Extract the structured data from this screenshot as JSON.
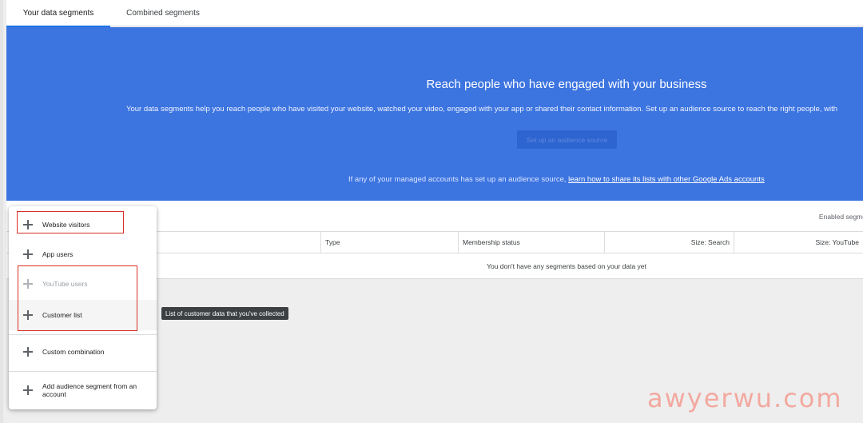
{
  "tabs": [
    {
      "label": "Your data segments",
      "active": true
    },
    {
      "label": "Combined segments",
      "active": false
    }
  ],
  "hero": {
    "title": "Reach people who have engaged with your business",
    "text": "Your data segments help you reach people who have visited your website, watched your video, engaged with your app or shared their contact information. Set up an audience source to reach the right people, with",
    "button_label": "Set up an audience source",
    "note_prefix": "If any of your managed accounts has set up an audience source, ",
    "note_link": "learn how to share its lists with other Google Ads accounts",
    "background_color": "#3c74e0"
  },
  "table": {
    "enabled_label": "Enabled segme",
    "columns": [
      "Type",
      "Membership status",
      "Size: Search",
      "Size: YouTube"
    ],
    "empty_message": "You don't have any segments based on your data yet"
  },
  "menu": {
    "items": [
      {
        "label": "Website visitors",
        "icon": "plus-icon",
        "disabled": false
      },
      {
        "label": "App users",
        "icon": "plus-icon",
        "disabled": false
      },
      {
        "label": "YouTube users",
        "icon": "plus-icon",
        "disabled": true
      },
      {
        "label": "Customer list",
        "icon": "plus-icon",
        "disabled": false
      },
      {
        "label": "Custom combination",
        "icon": "plus-icon",
        "disabled": false
      },
      {
        "label": "Add audience segment from an account",
        "icon": "plus-icon",
        "disabled": false
      }
    ]
  },
  "tooltip": "List of customer data that you've collected",
  "watermark": "awyerwu.com",
  "highlight_color": "#d93025"
}
